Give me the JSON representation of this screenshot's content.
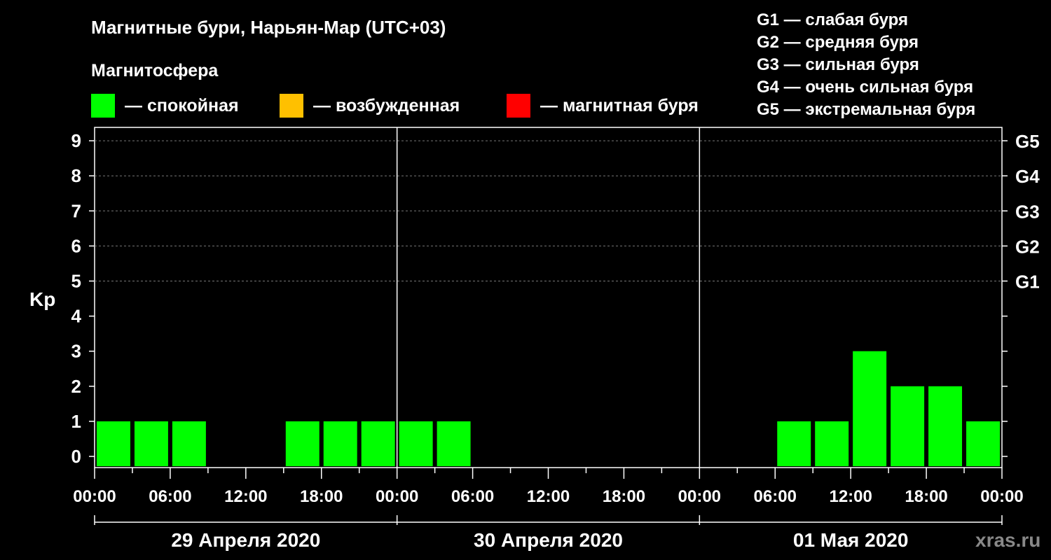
{
  "title": "Магнитные бури, Нарьян-Мар (UTC+03)",
  "magnetosphere_title": "Магнитосфера",
  "legend": [
    {
      "label": "— спокойная",
      "color": "#00ff00"
    },
    {
      "label": "— возбужденная",
      "color": "#ffc000"
    },
    {
      "label": "— магнитная буря",
      "color": "#ff0000"
    }
  ],
  "g_scale": [
    "G1 — слабая буря",
    "G2 — средняя буря",
    "G3 — сильная буря",
    "G4 — очень сильная буря",
    "G5 — экстремальная буря"
  ],
  "watermark": "xras.ru",
  "chart_data": {
    "type": "bar",
    "ylabel": "Kp",
    "ylim": [
      0,
      9
    ],
    "yticks": [
      0,
      1,
      2,
      3,
      4,
      5,
      6,
      7,
      8,
      9
    ],
    "right_labels": [
      {
        "kp": 5,
        "label": "G1"
      },
      {
        "kp": 6,
        "label": "G2"
      },
      {
        "kp": 7,
        "label": "G3"
      },
      {
        "kp": 8,
        "label": "G4"
      },
      {
        "kp": 9,
        "label": "G5"
      }
    ],
    "grid": "dashed horizontal at Kp 5-9",
    "x_tick_labels": [
      "00:00",
      "06:00",
      "12:00",
      "18:00",
      "00:00",
      "06:00",
      "12:00",
      "18:00",
      "00:00",
      "06:00",
      "12:00",
      "18:00",
      "00:00"
    ],
    "days": [
      "29 Апреля 2020",
      "30 Апреля 2020",
      "01 Мая 2020"
    ],
    "interval_hours": 3,
    "values": [
      1,
      1,
      1,
      0,
      0,
      1,
      1,
      1,
      1,
      1,
      0,
      0,
      0,
      0,
      0,
      0,
      0,
      0,
      1,
      1,
      3,
      2,
      2,
      1,
      0
    ],
    "thresholds": {
      "quiet_below": 4,
      "active": 4,
      "storm_from": 5
    },
    "colors": {
      "quiet": "#00ff00",
      "active": "#ffc000",
      "storm": "#ff0000"
    }
  }
}
